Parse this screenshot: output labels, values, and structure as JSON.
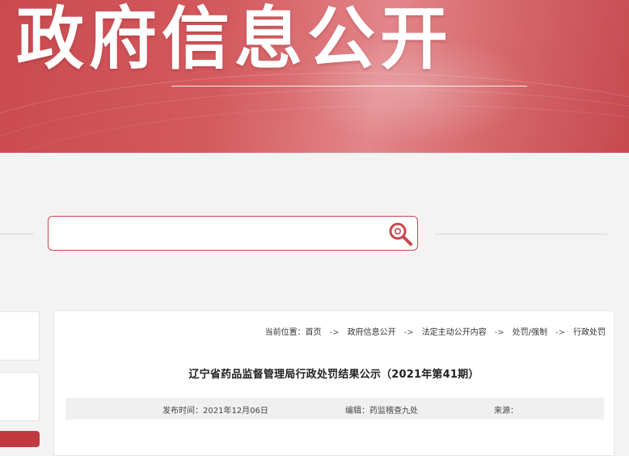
{
  "banner": {
    "title": "政府信息公开"
  },
  "search": {
    "value": "",
    "placeholder": ""
  },
  "breadcrumb": {
    "prefix": "当前位置：",
    "items": [
      "首页",
      "政府信息公开",
      "法定主动公开内容",
      "处罚/强制",
      "行政处罚"
    ],
    "separator": "->"
  },
  "article": {
    "title": "辽宁省药品监督管理局行政处罚结果公示（2021年第41期）",
    "publish_label": "发布时间：",
    "publish_date": "2021年12月06日",
    "editor_label": "编辑：",
    "editor": "药监稽查九处",
    "source_label": "来源：",
    "source": ""
  },
  "colors": {
    "accent": "#c9474c",
    "banner": "#d35a5e"
  },
  "icons": {
    "search": "search-icon"
  }
}
